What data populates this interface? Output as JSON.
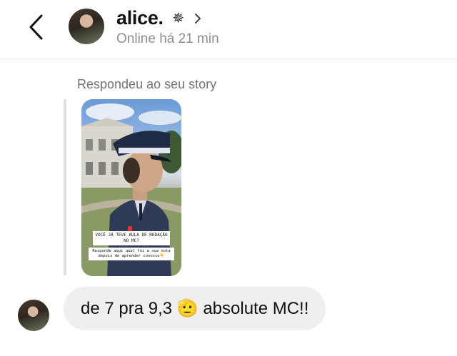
{
  "header": {
    "back_icon": "chevron-left-icon",
    "contact_name": "alice.",
    "name_badge_icon": "sparkle-icon",
    "name_badge_glyph": "✵",
    "profile_chevron_icon": "chevron-right-icon",
    "status": "Online há 21 min"
  },
  "story_reply": {
    "label": "Respondeu ao seu story",
    "sticker_question": "VOCÊ JÁ TEVE AULA DE REDAÇÃO NO MC?",
    "sticker_answer": "Responde aqui qual foi a sua nota depois de aprender conosco👇"
  },
  "messages": [
    {
      "sender": "alice.",
      "text": "de 7 pra 9,3 🫡 absolute MC!!"
    }
  ],
  "colors": {
    "bubble_bg": "#efefef",
    "muted_text": "#8e8e8e",
    "divider": "#e6e6e6"
  }
}
